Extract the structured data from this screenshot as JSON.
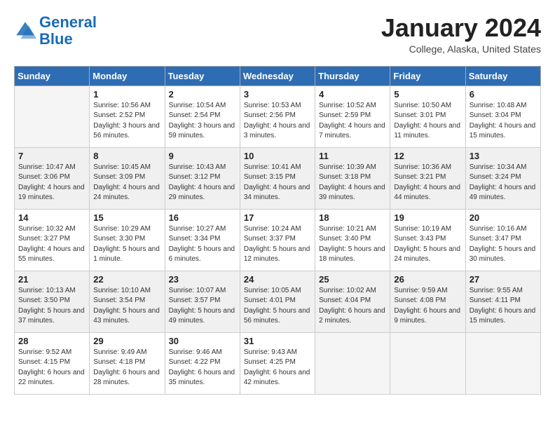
{
  "logo": {
    "text_general": "General",
    "text_blue": "Blue"
  },
  "header": {
    "month_year": "January 2024",
    "location": "College, Alaska, United States"
  },
  "weekdays": [
    "Sunday",
    "Monday",
    "Tuesday",
    "Wednesday",
    "Thursday",
    "Friday",
    "Saturday"
  ],
  "weeks": [
    [
      {
        "day": "",
        "empty": true
      },
      {
        "day": "1",
        "sunrise": "Sunrise: 10:56 AM",
        "sunset": "Sunset: 2:52 PM",
        "daylight": "Daylight: 3 hours and 56 minutes."
      },
      {
        "day": "2",
        "sunrise": "Sunrise: 10:54 AM",
        "sunset": "Sunset: 2:54 PM",
        "daylight": "Daylight: 3 hours and 59 minutes."
      },
      {
        "day": "3",
        "sunrise": "Sunrise: 10:53 AM",
        "sunset": "Sunset: 2:56 PM",
        "daylight": "Daylight: 4 hours and 3 minutes."
      },
      {
        "day": "4",
        "sunrise": "Sunrise: 10:52 AM",
        "sunset": "Sunset: 2:59 PM",
        "daylight": "Daylight: 4 hours and 7 minutes."
      },
      {
        "day": "5",
        "sunrise": "Sunrise: 10:50 AM",
        "sunset": "Sunset: 3:01 PM",
        "daylight": "Daylight: 4 hours and 11 minutes."
      },
      {
        "day": "6",
        "sunrise": "Sunrise: 10:48 AM",
        "sunset": "Sunset: 3:04 PM",
        "daylight": "Daylight: 4 hours and 15 minutes."
      }
    ],
    [
      {
        "day": "7",
        "sunrise": "Sunrise: 10:47 AM",
        "sunset": "Sunset: 3:06 PM",
        "daylight": "Daylight: 4 hours and 19 minutes."
      },
      {
        "day": "8",
        "sunrise": "Sunrise: 10:45 AM",
        "sunset": "Sunset: 3:09 PM",
        "daylight": "Daylight: 4 hours and 24 minutes."
      },
      {
        "day": "9",
        "sunrise": "Sunrise: 10:43 AM",
        "sunset": "Sunset: 3:12 PM",
        "daylight": "Daylight: 4 hours and 29 minutes."
      },
      {
        "day": "10",
        "sunrise": "Sunrise: 10:41 AM",
        "sunset": "Sunset: 3:15 PM",
        "daylight": "Daylight: 4 hours and 34 minutes."
      },
      {
        "day": "11",
        "sunrise": "Sunrise: 10:39 AM",
        "sunset": "Sunset: 3:18 PM",
        "daylight": "Daylight: 4 hours and 39 minutes."
      },
      {
        "day": "12",
        "sunrise": "Sunrise: 10:36 AM",
        "sunset": "Sunset: 3:21 PM",
        "daylight": "Daylight: 4 hours and 44 minutes."
      },
      {
        "day": "13",
        "sunrise": "Sunrise: 10:34 AM",
        "sunset": "Sunset: 3:24 PM",
        "daylight": "Daylight: 4 hours and 49 minutes."
      }
    ],
    [
      {
        "day": "14",
        "sunrise": "Sunrise: 10:32 AM",
        "sunset": "Sunset: 3:27 PM",
        "daylight": "Daylight: 4 hours and 55 minutes."
      },
      {
        "day": "15",
        "sunrise": "Sunrise: 10:29 AM",
        "sunset": "Sunset: 3:30 PM",
        "daylight": "Daylight: 5 hours and 1 minute."
      },
      {
        "day": "16",
        "sunrise": "Sunrise: 10:27 AM",
        "sunset": "Sunset: 3:34 PM",
        "daylight": "Daylight: 5 hours and 6 minutes."
      },
      {
        "day": "17",
        "sunrise": "Sunrise: 10:24 AM",
        "sunset": "Sunset: 3:37 PM",
        "daylight": "Daylight: 5 hours and 12 minutes."
      },
      {
        "day": "18",
        "sunrise": "Sunrise: 10:21 AM",
        "sunset": "Sunset: 3:40 PM",
        "daylight": "Daylight: 5 hours and 18 minutes."
      },
      {
        "day": "19",
        "sunrise": "Sunrise: 10:19 AM",
        "sunset": "Sunset: 3:43 PM",
        "daylight": "Daylight: 5 hours and 24 minutes."
      },
      {
        "day": "20",
        "sunrise": "Sunrise: 10:16 AM",
        "sunset": "Sunset: 3:47 PM",
        "daylight": "Daylight: 5 hours and 30 minutes."
      }
    ],
    [
      {
        "day": "21",
        "sunrise": "Sunrise: 10:13 AM",
        "sunset": "Sunset: 3:50 PM",
        "daylight": "Daylight: 5 hours and 37 minutes."
      },
      {
        "day": "22",
        "sunrise": "Sunrise: 10:10 AM",
        "sunset": "Sunset: 3:54 PM",
        "daylight": "Daylight: 5 hours and 43 minutes."
      },
      {
        "day": "23",
        "sunrise": "Sunrise: 10:07 AM",
        "sunset": "Sunset: 3:57 PM",
        "daylight": "Daylight: 5 hours and 49 minutes."
      },
      {
        "day": "24",
        "sunrise": "Sunrise: 10:05 AM",
        "sunset": "Sunset: 4:01 PM",
        "daylight": "Daylight: 5 hours and 56 minutes."
      },
      {
        "day": "25",
        "sunrise": "Sunrise: 10:02 AM",
        "sunset": "Sunset: 4:04 PM",
        "daylight": "Daylight: 6 hours and 2 minutes."
      },
      {
        "day": "26",
        "sunrise": "Sunrise: 9:59 AM",
        "sunset": "Sunset: 4:08 PM",
        "daylight": "Daylight: 6 hours and 9 minutes."
      },
      {
        "day": "27",
        "sunrise": "Sunrise: 9:55 AM",
        "sunset": "Sunset: 4:11 PM",
        "daylight": "Daylight: 6 hours and 15 minutes."
      }
    ],
    [
      {
        "day": "28",
        "sunrise": "Sunrise: 9:52 AM",
        "sunset": "Sunset: 4:15 PM",
        "daylight": "Daylight: 6 hours and 22 minutes."
      },
      {
        "day": "29",
        "sunrise": "Sunrise: 9:49 AM",
        "sunset": "Sunset: 4:18 PM",
        "daylight": "Daylight: 6 hours and 28 minutes."
      },
      {
        "day": "30",
        "sunrise": "Sunrise: 9:46 AM",
        "sunset": "Sunset: 4:22 PM",
        "daylight": "Daylight: 6 hours and 35 minutes."
      },
      {
        "day": "31",
        "sunrise": "Sunrise: 9:43 AM",
        "sunset": "Sunset: 4:25 PM",
        "daylight": "Daylight: 6 hours and 42 minutes."
      },
      {
        "day": "",
        "empty": true
      },
      {
        "day": "",
        "empty": true
      },
      {
        "day": "",
        "empty": true
      }
    ]
  ]
}
